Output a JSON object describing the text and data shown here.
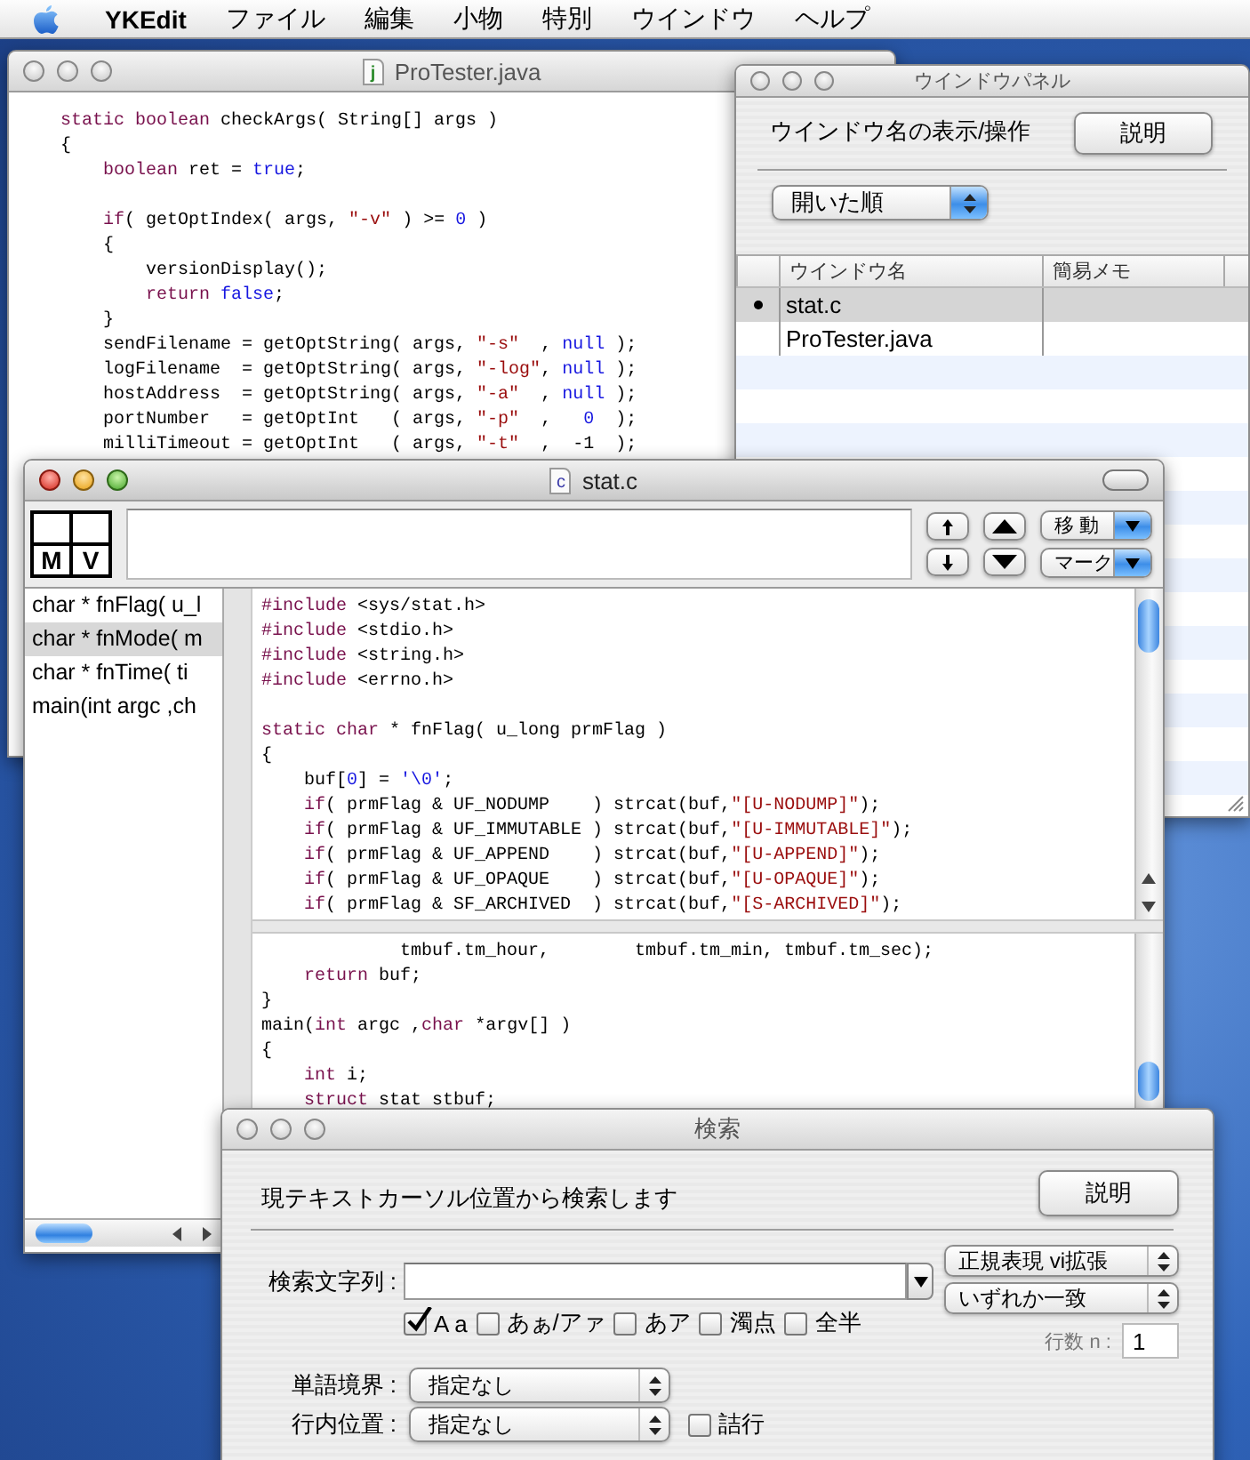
{
  "menu_bar": {
    "app_name": "YKEdit",
    "items": [
      "ファイル",
      "編集",
      "小物",
      "特別",
      "ウインドウ",
      "ヘルプ"
    ]
  },
  "protester_window": {
    "title": "ProTester.java",
    "active": false,
    "file_icon_letter": "j",
    "code": [
      {
        "kind": "code",
        "segments": [
          {
            "kind": "keyword",
            "text": "static boolean"
          },
          {
            "kind": "plain",
            "text": " checkArgs( String[] args )"
          }
        ]
      },
      {
        "kind": "code",
        "segments": [
          {
            "kind": "plain",
            "text": "{"
          }
        ]
      },
      {
        "kind": "code",
        "segments": [
          {
            "kind": "keyword",
            "text": "    boolean"
          },
          {
            "kind": "plain",
            "text": " ret = "
          },
          {
            "kind": "literal",
            "text": "true"
          },
          {
            "kind": "plain",
            "text": ";"
          }
        ]
      },
      {
        "kind": "blank"
      },
      {
        "kind": "code",
        "segments": [
          {
            "kind": "keyword",
            "text": "    if"
          },
          {
            "kind": "plain",
            "text": "( getOptIndex( args, "
          },
          {
            "kind": "string",
            "text": "\"-v\""
          },
          {
            "kind": "plain",
            "text": " ) >= "
          },
          {
            "kind": "literal",
            "text": "0"
          },
          {
            "kind": "plain",
            "text": " )"
          }
        ]
      },
      {
        "kind": "code",
        "segments": [
          {
            "kind": "plain",
            "text": "    {"
          }
        ]
      },
      {
        "kind": "code",
        "segments": [
          {
            "kind": "plain",
            "text": "        versionDisplay();"
          }
        ]
      },
      {
        "kind": "code",
        "segments": [
          {
            "kind": "keyword",
            "text": "        return"
          },
          {
            "kind": "literal",
            "text": " false"
          },
          {
            "kind": "plain",
            "text": ";"
          }
        ]
      },
      {
        "kind": "code",
        "segments": [
          {
            "kind": "plain",
            "text": "    }"
          }
        ]
      },
      {
        "kind": "code",
        "segments": [
          {
            "kind": "plain",
            "text": "    sendFilename = getOptString( args, "
          },
          {
            "kind": "string",
            "text": "\"-s\""
          },
          {
            "kind": "plain",
            "text": "  , "
          },
          {
            "kind": "literal",
            "text": "null"
          },
          {
            "kind": "plain",
            "text": " );"
          }
        ]
      },
      {
        "kind": "code",
        "segments": [
          {
            "kind": "plain",
            "text": "    logFilename  = getOptString( args, "
          },
          {
            "kind": "string",
            "text": "\"-log\""
          },
          {
            "kind": "plain",
            "text": ", "
          },
          {
            "kind": "literal",
            "text": "null"
          },
          {
            "kind": "plain",
            "text": " );"
          }
        ]
      },
      {
        "kind": "code",
        "segments": [
          {
            "kind": "plain",
            "text": "    hostAddress  = getOptString( args, "
          },
          {
            "kind": "string",
            "text": "\"-a\""
          },
          {
            "kind": "plain",
            "text": "  , "
          },
          {
            "kind": "literal",
            "text": "null"
          },
          {
            "kind": "plain",
            "text": " );"
          }
        ]
      },
      {
        "kind": "code",
        "segments": [
          {
            "kind": "plain",
            "text": "    portNumber   = getOptInt   ( args, "
          },
          {
            "kind": "string",
            "text": "\"-p\""
          },
          {
            "kind": "plain",
            "text": "  ,   "
          },
          {
            "kind": "literal",
            "text": "0"
          },
          {
            "kind": "plain",
            "text": "  );"
          }
        ]
      },
      {
        "kind": "code",
        "segments": [
          {
            "kind": "plain",
            "text": "    milliTimeout = getOptInt   ( args, "
          },
          {
            "kind": "string",
            "text": "\"-t\""
          },
          {
            "kind": "plain",
            "text": "  ,  -1  );"
          }
        ]
      }
    ]
  },
  "window_panel": {
    "title": "ウインドウパネル",
    "active": false,
    "caption": "ウインドウ名の表示/操作",
    "help_button": "説明",
    "sort_popup": "開いた順",
    "columns": [
      "ウインドウ名",
      "簡易メモ"
    ],
    "rows": [
      {
        "name": "stat.c",
        "current": true,
        "selected": true
      },
      {
        "name": "ProTester.java",
        "current": false,
        "selected": false
      }
    ]
  },
  "stat_window": {
    "title": "stat.c",
    "active": true,
    "file_icon_letter": "c",
    "mark_box": [
      "M",
      "V"
    ],
    "jump_popup": "移 動",
    "mark_popup": "マーク",
    "functions": [
      {
        "text": "char * fnFlag( u_l",
        "selected": false
      },
      {
        "text": "char * fnMode( m",
        "selected": true
      },
      {
        "text": "char * fnTime( ti",
        "selected": false
      },
      {
        "text": "main(int argc ,ch",
        "selected": false
      }
    ],
    "code_upper": [
      {
        "kind": "code",
        "segments": [
          {
            "kind": "keyword",
            "text": "#include"
          },
          {
            "kind": "plain",
            "text": " <sys/stat.h>"
          }
        ]
      },
      {
        "kind": "code",
        "segments": [
          {
            "kind": "keyword",
            "text": "#include"
          },
          {
            "kind": "plain",
            "text": " <stdio.h>"
          }
        ]
      },
      {
        "kind": "code",
        "segments": [
          {
            "kind": "keyword",
            "text": "#include"
          },
          {
            "kind": "plain",
            "text": " <string.h>"
          }
        ]
      },
      {
        "kind": "code",
        "segments": [
          {
            "kind": "keyword",
            "text": "#include"
          },
          {
            "kind": "plain",
            "text": " <errno.h>"
          }
        ]
      },
      {
        "kind": "blank"
      },
      {
        "kind": "code",
        "segments": [
          {
            "kind": "keyword",
            "text": "static char"
          },
          {
            "kind": "plain",
            "text": " * fnFlag( u_long prmFlag )"
          }
        ]
      },
      {
        "kind": "code",
        "segments": [
          {
            "kind": "plain",
            "text": "{"
          }
        ]
      },
      {
        "kind": "code",
        "segments": [
          {
            "kind": "plain",
            "text": "    buf["
          },
          {
            "kind": "literal",
            "text": "0"
          },
          {
            "kind": "plain",
            "text": "] = "
          },
          {
            "kind": "literal",
            "text": "'\\0'"
          },
          {
            "kind": "plain",
            "text": ";"
          }
        ]
      },
      {
        "kind": "code",
        "segments": [
          {
            "kind": "keyword",
            "text": "    if"
          },
          {
            "kind": "plain",
            "text": "( prmFlag & UF_NODUMP    ) strcat(buf,"
          },
          {
            "kind": "string",
            "text": "\"[U-NODUMP]\""
          },
          {
            "kind": "plain",
            "text": ");"
          }
        ]
      },
      {
        "kind": "code",
        "segments": [
          {
            "kind": "keyword",
            "text": "    if"
          },
          {
            "kind": "plain",
            "text": "( prmFlag & UF_IMMUTABLE ) strcat(buf,"
          },
          {
            "kind": "string",
            "text": "\"[U-IMMUTABLE]\""
          },
          {
            "kind": "plain",
            "text": ");"
          }
        ]
      },
      {
        "kind": "code",
        "segments": [
          {
            "kind": "keyword",
            "text": "    if"
          },
          {
            "kind": "plain",
            "text": "( prmFlag & UF_APPEND    ) strcat(buf,"
          },
          {
            "kind": "string",
            "text": "\"[U-APPEND]\""
          },
          {
            "kind": "plain",
            "text": ");"
          }
        ]
      },
      {
        "kind": "code",
        "segments": [
          {
            "kind": "keyword",
            "text": "    if"
          },
          {
            "kind": "plain",
            "text": "( prmFlag & UF_OPAQUE    ) strcat(buf,"
          },
          {
            "kind": "string",
            "text": "\"[U-OPAQUE]\""
          },
          {
            "kind": "plain",
            "text": ");"
          }
        ]
      },
      {
        "kind": "code",
        "segments": [
          {
            "kind": "keyword",
            "text": "    if"
          },
          {
            "kind": "plain",
            "text": "( prmFlag & SF_ARCHIVED  ) strcat(buf,"
          },
          {
            "kind": "string",
            "text": "\"[S-ARCHIVED]\""
          },
          {
            "kind": "plain",
            "text": ");"
          }
        ]
      }
    ],
    "code_lower": [
      {
        "kind": "code",
        "segments": [
          {
            "kind": "plain",
            "text": "             tmbuf.tm_hour,        tmbuf.tm_min, tmbuf.tm_sec);"
          }
        ]
      },
      {
        "kind": "code",
        "segments": [
          {
            "kind": "keyword",
            "text": "    return"
          },
          {
            "kind": "plain",
            "text": " buf;"
          }
        ]
      },
      {
        "kind": "code",
        "segments": [
          {
            "kind": "plain",
            "text": "}"
          }
        ]
      },
      {
        "kind": "code",
        "segments": [
          {
            "kind": "plain",
            "text": "main("
          },
          {
            "kind": "keyword",
            "text": "int"
          },
          {
            "kind": "plain",
            "text": " argc ,"
          },
          {
            "kind": "keyword",
            "text": "char"
          },
          {
            "kind": "plain",
            "text": " *argv[] )"
          }
        ]
      },
      {
        "kind": "code",
        "segments": [
          {
            "kind": "plain",
            "text": "{"
          }
        ]
      },
      {
        "kind": "code",
        "segments": [
          {
            "kind": "keyword",
            "text": "    int"
          },
          {
            "kind": "plain",
            "text": " i;"
          }
        ]
      },
      {
        "kind": "code",
        "segments": [
          {
            "kind": "keyword",
            "text": "    struct"
          },
          {
            "kind": "plain",
            "text": " stat stbuf;"
          }
        ]
      }
    ]
  },
  "search_window": {
    "title": "検索",
    "active": false,
    "description": "現テキストカーソル位置から検索します",
    "help_button": "説明",
    "search_label": "検索文字列 :",
    "mode_popup": "正規表現 vi拡張",
    "match_popup": "いずれか一致",
    "options": [
      {
        "label": "A a",
        "checked": true
      },
      {
        "label": "あぁ/アァ",
        "checked": false
      },
      {
        "label": "あア",
        "checked": false
      },
      {
        "label": "濁点",
        "checked": false
      },
      {
        "label": "全半",
        "checked": false
      }
    ],
    "lines_label": "行数 n :",
    "lines_value": "1",
    "word_boundary_label": "単語境界 :",
    "word_boundary_popup": "指定なし",
    "line_position_label": "行内位置 :",
    "line_position_popup": "指定なし",
    "compact": {
      "label": "詰行",
      "checked": false
    }
  }
}
